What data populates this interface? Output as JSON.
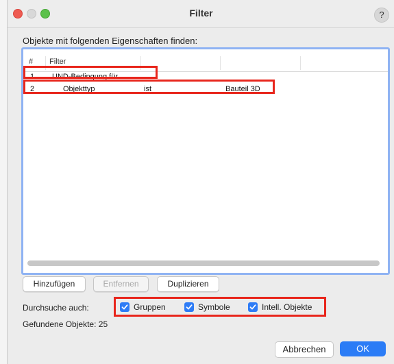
{
  "window": {
    "title": "Filter",
    "help_label": "?"
  },
  "heading": "Objekte mit folgenden Eigenschaften finden:",
  "table": {
    "columns": [
      "#",
      "Filter"
    ],
    "rows": [
      {
        "num": "1",
        "cells": [
          "UND-Bedingung für..."
        ]
      },
      {
        "num": "2",
        "cells": [
          "Objekttyp",
          "ist",
          "Bauteil 3D"
        ]
      }
    ]
  },
  "buttons": {
    "add": "Hinzufügen",
    "remove": "Entfernen",
    "duplicate": "Duplizieren"
  },
  "search_also": {
    "label": "Durchsuche auch:",
    "options": [
      {
        "label": "Gruppen",
        "checked": true
      },
      {
        "label": "Symbole",
        "checked": true
      },
      {
        "label": "Intell. Objekte",
        "checked": true
      }
    ]
  },
  "found": {
    "label": "Gefundene Objekte:",
    "count": "25"
  },
  "footer": {
    "cancel": "Abbrechen",
    "ok": "OK"
  },
  "colors": {
    "accent": "#2b7cf6",
    "highlight": "#e8261c",
    "focus_ring": "#8fb3f3"
  }
}
